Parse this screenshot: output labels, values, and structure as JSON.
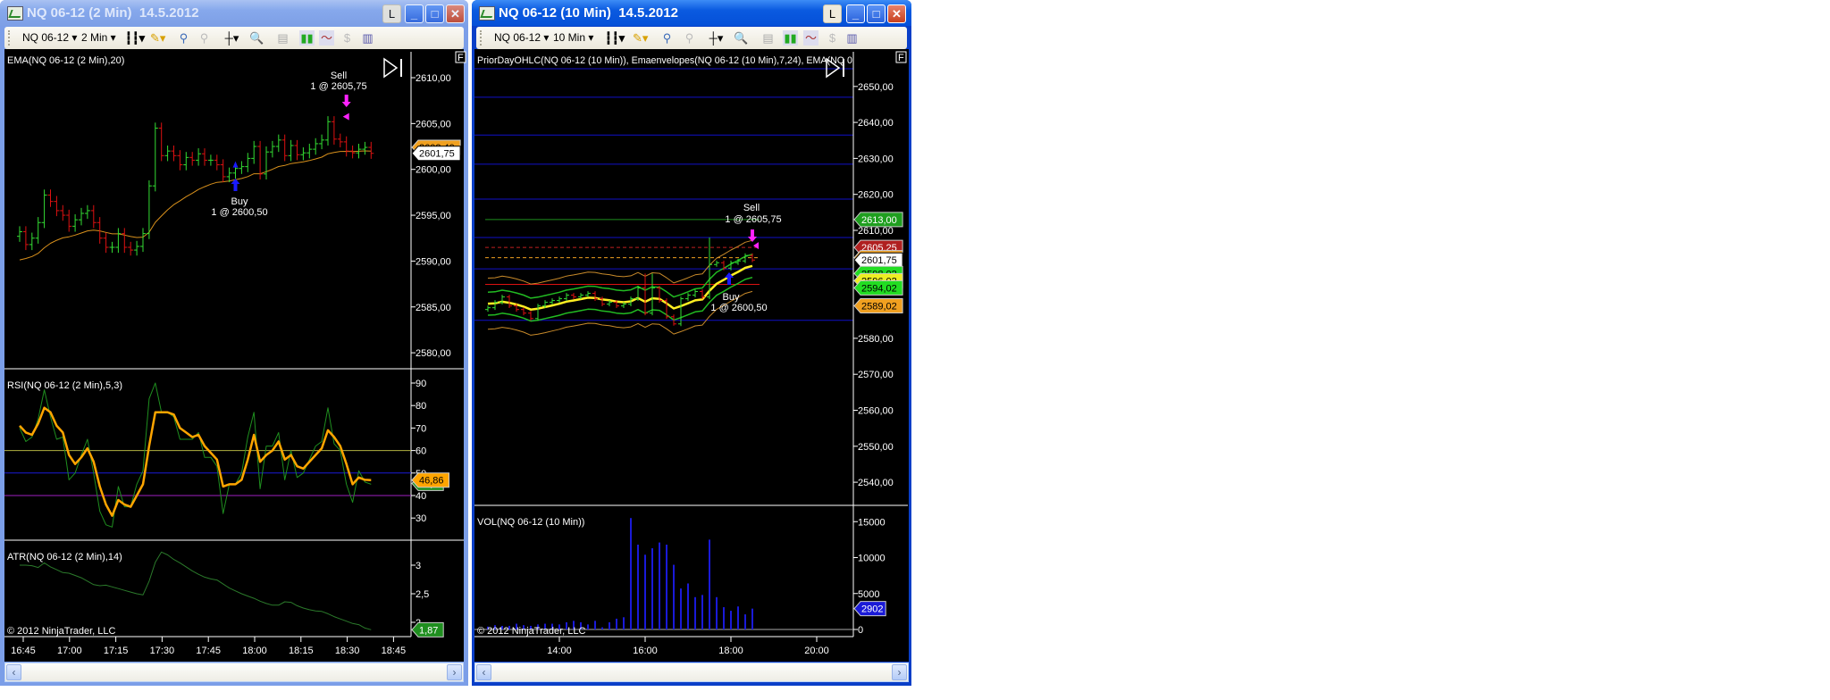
{
  "left_window": {
    "title": "NQ 06-12 (2 Min)  14.5.2012",
    "buttons": {
      "layout": "L",
      "minimize": "_",
      "maximize": "□",
      "close": "✕"
    },
    "toolbar": {
      "instrument": "NQ 06-12",
      "interval": "2 Min",
      "icons": [
        "bar-style-icon",
        "pencil-draw-icon",
        "add-indicator-icon",
        "strategy-icon",
        "crosshair-icon",
        "zoom-icon",
        "data-box-icon",
        "chart-trader-icon",
        "properties-icon",
        "dollar-icon",
        "template-icon"
      ]
    },
    "indicator_labels": {
      "price": "EMA(NQ 06-12 (2 Min),20)",
      "rsi": "RSI(NQ 06-12 (2 Min),5,3)",
      "atr": "ATR(NQ 06-12 (2 Min),14)"
    },
    "copyright": "© 2012 NinjaTrader, LLC",
    "f_button": "F",
    "trades": {
      "buy": {
        "label": "Buy",
        "detail": "1 @ 2600,50",
        "bar": 35,
        "price": 2600.5
      },
      "sell": {
        "label": "Sell",
        "detail": "1 @ 2605,75",
        "bar": 53,
        "price": 2605.75
      }
    }
  },
  "right_window": {
    "title": "NQ 06-12 (10 Min)  14.5.2012",
    "buttons": {
      "layout": "L",
      "minimize": "_",
      "maximize": "□",
      "close": "✕"
    },
    "toolbar": {
      "instrument": "NQ 06-12",
      "interval": "10 Min"
    },
    "indicator_labels": {
      "price": "PriorDayOHLC(NQ 06-12 (10 Min)), Emaenvelopes(NQ 06-12 (10 Min),7,24), EMA(NQ 0",
      "vol": "VOL(NQ 06-12 (10 Min))"
    },
    "copyright": "© 2012 NinjaTrader, LLC",
    "f_button": "F",
    "trades": {
      "buy": {
        "label": "Buy",
        "detail": "1 @ 2600,50",
        "bar": 34,
        "price": 2600.5
      },
      "sell": {
        "label": "Sell",
        "detail": "1 @ 2605,75",
        "bar": 37,
        "price": 2605.75
      }
    }
  },
  "colors": {
    "up": "#33dd33",
    "down": "#dd1111",
    "ema": "#d8901c",
    "rsi": "#ffa500",
    "rsi_raw": "#1f8f1f",
    "atr": "#2b7a2b",
    "volume": "#1a1ad8",
    "level_blue": "#1010c8",
    "buy": "#1a1aff",
    "sell": "#ff22ff"
  },
  "chart_data": [
    {
      "id": "left-price",
      "type": "ohlc",
      "title": "EMA(NQ 06-12 (2 Min),20)",
      "interval": "2 Min",
      "close": [
        2593.2,
        2591.8,
        2592.5,
        2594.2,
        2597.2,
        2596.5,
        2595.5,
        2595,
        2593.8,
        2594.5,
        2595.2,
        2595.5,
        2594.2,
        2592.5,
        2591.5,
        2591.5,
        2593,
        2591.5,
        2591.2,
        2591.6,
        2593,
        2598.2,
        2604.5,
        2601.5,
        2602,
        2601.5,
        2600.5,
        2601.3,
        2601,
        2601.7,
        2601,
        2601,
        2600.5,
        2599.2,
        2599.6,
        2600.1,
        2600.3,
        2601.2,
        2602.5,
        2599.5,
        2601.9,
        2602.5,
        2603.2,
        2601.5,
        2602.6,
        2601.6,
        2601.8,
        2602.2,
        2602.8,
        2603.2,
        2605.2,
        2603.3,
        2603,
        2602,
        2601.8,
        2602.2,
        2602.4,
        2601.75
      ],
      "ema_period": 20,
      "ema_seed": 2589.8,
      "ylim": [
        2578,
        2612
      ],
      "yticks": [
        {
          "v": 2610,
          "label": "2610,00"
        },
        {
          "v": 2605,
          "label": "2605,00"
        },
        {
          "v": 2600,
          "label": "2600,00"
        },
        {
          "v": 2595,
          "label": "2595,00"
        },
        {
          "v": 2590,
          "label": "2590,00"
        },
        {
          "v": 2585,
          "label": "2585,00"
        },
        {
          "v": 2580,
          "label": "2580,00"
        }
      ],
      "tags": [
        {
          "v": 2602.4,
          "label": "2602,40",
          "bg": "#f0a020",
          "fg": "#000"
        },
        {
          "v": 2601.75,
          "label": "2601,75",
          "bg": "#ffffff",
          "fg": "#000"
        }
      ]
    },
    {
      "id": "left-rsi",
      "type": "line",
      "title": "RSI(NQ 06-12 (2 Min),5,3)",
      "series": [
        {
          "name": "RSI",
          "values": [
            71,
            68,
            67,
            72,
            79,
            77,
            71,
            68,
            58,
            54,
            57,
            61,
            55,
            44,
            36,
            31,
            38,
            36,
            35,
            40,
            45,
            62,
            77,
            77,
            77,
            76,
            70,
            68,
            66,
            67,
            62,
            59,
            56,
            44,
            45,
            45,
            47,
            56,
            67,
            55,
            58,
            60,
            64,
            56,
            58,
            53,
            52,
            55,
            58,
            61,
            69,
            66,
            62,
            54,
            45,
            48,
            47,
            46.86
          ]
        },
        {
          "name": "RSI raw",
          "values": [
            70,
            64,
            66,
            74,
            87,
            75,
            65,
            66,
            47,
            50,
            58,
            65,
            50,
            33,
            27,
            26,
            44,
            35,
            35,
            45,
            51,
            83,
            90,
            77,
            77,
            75,
            65,
            65,
            65,
            68,
            57,
            57,
            53,
            32,
            45,
            45,
            50,
            66,
            77,
            43,
            62,
            62,
            68,
            47,
            60,
            48,
            50,
            56,
            62,
            64,
            79,
            63,
            60,
            45,
            37,
            51,
            46,
            45
          ]
        }
      ],
      "levels": [
        {
          "v": 60,
          "color": "#b0b040"
        },
        {
          "v": 50,
          "color": "#1a1ad8"
        },
        {
          "v": 40,
          "color": "#a020c0"
        }
      ],
      "ylim": [
        20,
        95
      ],
      "yticks": [
        {
          "v": 90,
          "label": "90"
        },
        {
          "v": 80,
          "label": "80"
        },
        {
          "v": 70,
          "label": "70"
        },
        {
          "v": 60,
          "label": "60"
        },
        {
          "v": 50,
          "label": "50"
        },
        {
          "v": 40,
          "label": "40"
        },
        {
          "v": 30,
          "label": "30"
        }
      ],
      "tags": [
        {
          "v": 45.4,
          "label": "45,4",
          "bg": "#1f8f1f",
          "fg": "#fff"
        },
        {
          "v": 46.86,
          "label": "46,86",
          "bg": "#ffa500",
          "fg": "#000"
        }
      ]
    },
    {
      "id": "left-atr",
      "type": "line",
      "title": "ATR(NQ 06-12 (2 Min),14)",
      "series": [
        {
          "name": "ATR",
          "values": [
            3.0,
            3.0,
            2.99,
            2.96,
            3.04,
            2.97,
            2.92,
            2.87,
            2.86,
            2.82,
            2.78,
            2.72,
            2.66,
            2.64,
            2.65,
            2.62,
            2.59,
            2.56,
            2.53,
            2.5,
            2.48,
            2.72,
            3.05,
            3.23,
            3.18,
            3.1,
            3.04,
            2.97,
            2.9,
            2.84,
            2.79,
            2.76,
            2.74,
            2.67,
            2.6,
            2.55,
            2.5,
            2.46,
            2.42,
            2.37,
            2.33,
            2.3,
            2.3,
            2.36,
            2.35,
            2.29,
            2.25,
            2.22,
            2.2,
            2.19,
            2.15,
            2.1,
            2.06,
            2.02,
            1.98,
            1.96,
            1.9,
            1.87
          ]
        }
      ],
      "yticks": [
        {
          "v": 3,
          "label": "3"
        },
        {
          "v": 2.5,
          "label": "2,5"
        },
        {
          "v": 2,
          "label": "2"
        }
      ],
      "tags": [
        {
          "v": 1.87,
          "label": "1,87",
          "bg": "#1f8f1f",
          "fg": "#fff"
        }
      ]
    },
    {
      "id": "left-time-axis",
      "type": "axis",
      "xticks": [
        "16:45",
        "17:00",
        "17:15",
        "17:30",
        "17:45",
        "18:00",
        "18:15",
        "18:30",
        "18:45"
      ]
    },
    {
      "id": "right-price",
      "type": "ohlc",
      "title": "PriorDayOHLC / Emaenvelopes / EMA",
      "interval": "10 Min",
      "close": [
        2588.5,
        2590,
        2591.5,
        2589,
        2588,
        2587,
        2585.5,
        2589,
        2590,
        2590.5,
        2591,
        2592,
        2591.5,
        2592,
        2592.5,
        2591,
        2589.5,
        2590,
        2589,
        2589.5,
        2591,
        2594,
        2587,
        2594,
        2590.5,
        2586,
        2584,
        2591,
        2592,
        2593,
        2591.5,
        2600.5,
        2601,
        2599.5,
        2601,
        2601.5,
        2603,
        2601.75
      ],
      "overrides": {
        "31": {
          "high": 2608
        },
        "26": {
          "low": 2583.5
        },
        "22": {
          "high": 2598
        },
        "23": {
          "high": 2598
        }
      },
      "ema_period": 7,
      "ema_seed": 2590,
      "envelope_inner": 3.2,
      "envelope_outer": 7.1,
      "levels": [
        {
          "v": 2613,
          "color": "#1f8f1f",
          "dash": false
        },
        {
          "v": 2605.25,
          "color": "#c02020",
          "dash": true
        },
        {
          "v": 2602.4,
          "color": "#f0a020",
          "dash": true
        },
        {
          "v": 2595,
          "color": "#dd1111",
          "dash": false
        }
      ],
      "blue_levels": [
        2654.9,
        2647,
        2636.5,
        2628.4,
        2618.7,
        2608,
        2599.3,
        2585
      ],
      "yticks": [
        {
          "v": 2650,
          "label": "2650,00"
        },
        {
          "v": 2640,
          "label": "2640,00"
        },
        {
          "v": 2630,
          "label": "2630,00"
        },
        {
          "v": 2620,
          "label": "2620,00"
        },
        {
          "v": 2610,
          "label": "2610,00"
        },
        {
          "v": 2580,
          "label": "2580,00"
        },
        {
          "v": 2570,
          "label": "2570,00"
        },
        {
          "v": 2560,
          "label": "2560,00"
        },
        {
          "v": 2550,
          "label": "2550,00"
        },
        {
          "v": 2540,
          "label": "2540,00"
        }
      ],
      "tags": [
        {
          "v": 2613,
          "label": "2613,00",
          "bg": "#1f9f1f",
          "fg": "#fff"
        },
        {
          "v": 2605.25,
          "label": "2605,25",
          "bg": "#b02020",
          "fg": "#fff"
        },
        {
          "v": 2602.4,
          "label": "2602,40",
          "bg": "#f0a020",
          "fg": "#000"
        },
        {
          "v": 2601.75,
          "label": "2601,75",
          "bg": "#ffffff",
          "fg": "#000"
        },
        {
          "v": 2598.02,
          "label": "2598,02",
          "bg": "#22dd22",
          "fg": "#000"
        },
        {
          "v": 2596,
          "label": "2596,02",
          "bg": "#eeee22",
          "fg": "#000"
        },
        {
          "v": 2594.02,
          "label": "2594,02",
          "bg": "#22dd22",
          "fg": "#000"
        },
        {
          "v": 2589.02,
          "label": "2589,02",
          "bg": "#f0a020",
          "fg": "#000"
        }
      ]
    },
    {
      "id": "right-volume",
      "type": "bar",
      "title": "VOL(NQ 06-12 (10 Min))",
      "values": [
        400,
        600,
        500,
        500,
        800,
        600,
        500,
        700,
        800,
        800,
        700,
        1000,
        1200,
        1000,
        700,
        1200,
        300,
        1000,
        1500,
        1700,
        15500,
        11800,
        10400,
        11300,
        12100,
        11800,
        9000,
        5700,
        6400,
        4500,
        4800,
        12500,
        4500,
        3100,
        2600,
        3200,
        2100,
        2902
      ],
      "ylim": [
        0,
        16000
      ],
      "yticks": [
        {
          "v": 15000,
          "label": "15000"
        },
        {
          "v": 10000,
          "label": "10000"
        },
        {
          "v": 5000,
          "label": "5000"
        },
        {
          "v": 0,
          "label": "0"
        }
      ],
      "tags": [
        {
          "v": 2902,
          "label": "2902",
          "bg": "#1a1ad8",
          "fg": "#fff"
        }
      ]
    },
    {
      "id": "right-time-axis",
      "type": "axis",
      "xticks": [
        "14:00",
        "16:00",
        "18:00",
        "20:00"
      ]
    }
  ]
}
